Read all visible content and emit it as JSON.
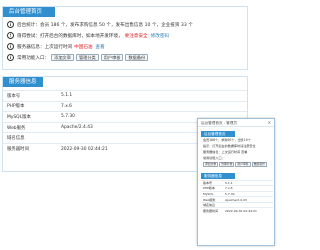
{
  "status_panel": {
    "title": "后台管理首页",
    "rows": [
      {
        "icon": "i",
        "text": "后台统计：会员 186 个，发布求购信息 50 个，发布出售信息 10 个，企业投资 33 个"
      },
      {
        "icon": "!",
        "text": "值得尝试：打开后台的数据库时，如本地开发环境，",
        "warn": "要注意安全",
        "link": "修改密码"
      },
      {
        "icon": "i",
        "text": "服务器信息：上次运行时间",
        "warn": "中国石油",
        "link": "查看"
      },
      {
        "icon": "i",
        "text": "常用功能入口："
      }
    ],
    "buttons": [
      "添加文章",
      "管理分类",
      "用户审核",
      "数据备份"
    ]
  },
  "system_panel": {
    "title": "服务器信息",
    "rows": [
      {
        "key": "版本号",
        "value": "5.1.1"
      },
      {
        "key": "PHP版本",
        "value": "7.x.6"
      },
      {
        "key": "MySQL版本",
        "value": "5.7.30"
      },
      {
        "key": "Web服务",
        "value": "Apache/2.4.43"
      },
      {
        "key": "域名信息",
        "value": ""
      },
      {
        "key": "服务器时间",
        "value": "2022-09-30 02:44:21"
      }
    ]
  },
  "popup": {
    "bar_text": "后台管理首页 - 管理员",
    "close": "×",
    "title": "后台管理首页",
    "lines": [
      "会员186个，求购50个，出售10个",
      "提示：打开后台的数据库时请注意安全",
      "服务器信息：上次运行时间 查看",
      "常用功能入口："
    ],
    "buttons": [
      "添加文章",
      "管理分类",
      "用户审核",
      "数据备份"
    ],
    "section2_title": "服务器信息",
    "rows": [
      {
        "key": "版本号",
        "value": "5.1.1"
      },
      {
        "key": "PHP版本",
        "value": "7.x.6"
      },
      {
        "key": "MySQL",
        "value": "5.7.30"
      },
      {
        "key": "Web服务",
        "value": "Apache/2.4.43"
      },
      {
        "key": "域名信息",
        "value": ""
      },
      {
        "key": "服务器时间",
        "value": "2022-09-30 02:44:21"
      }
    ]
  }
}
